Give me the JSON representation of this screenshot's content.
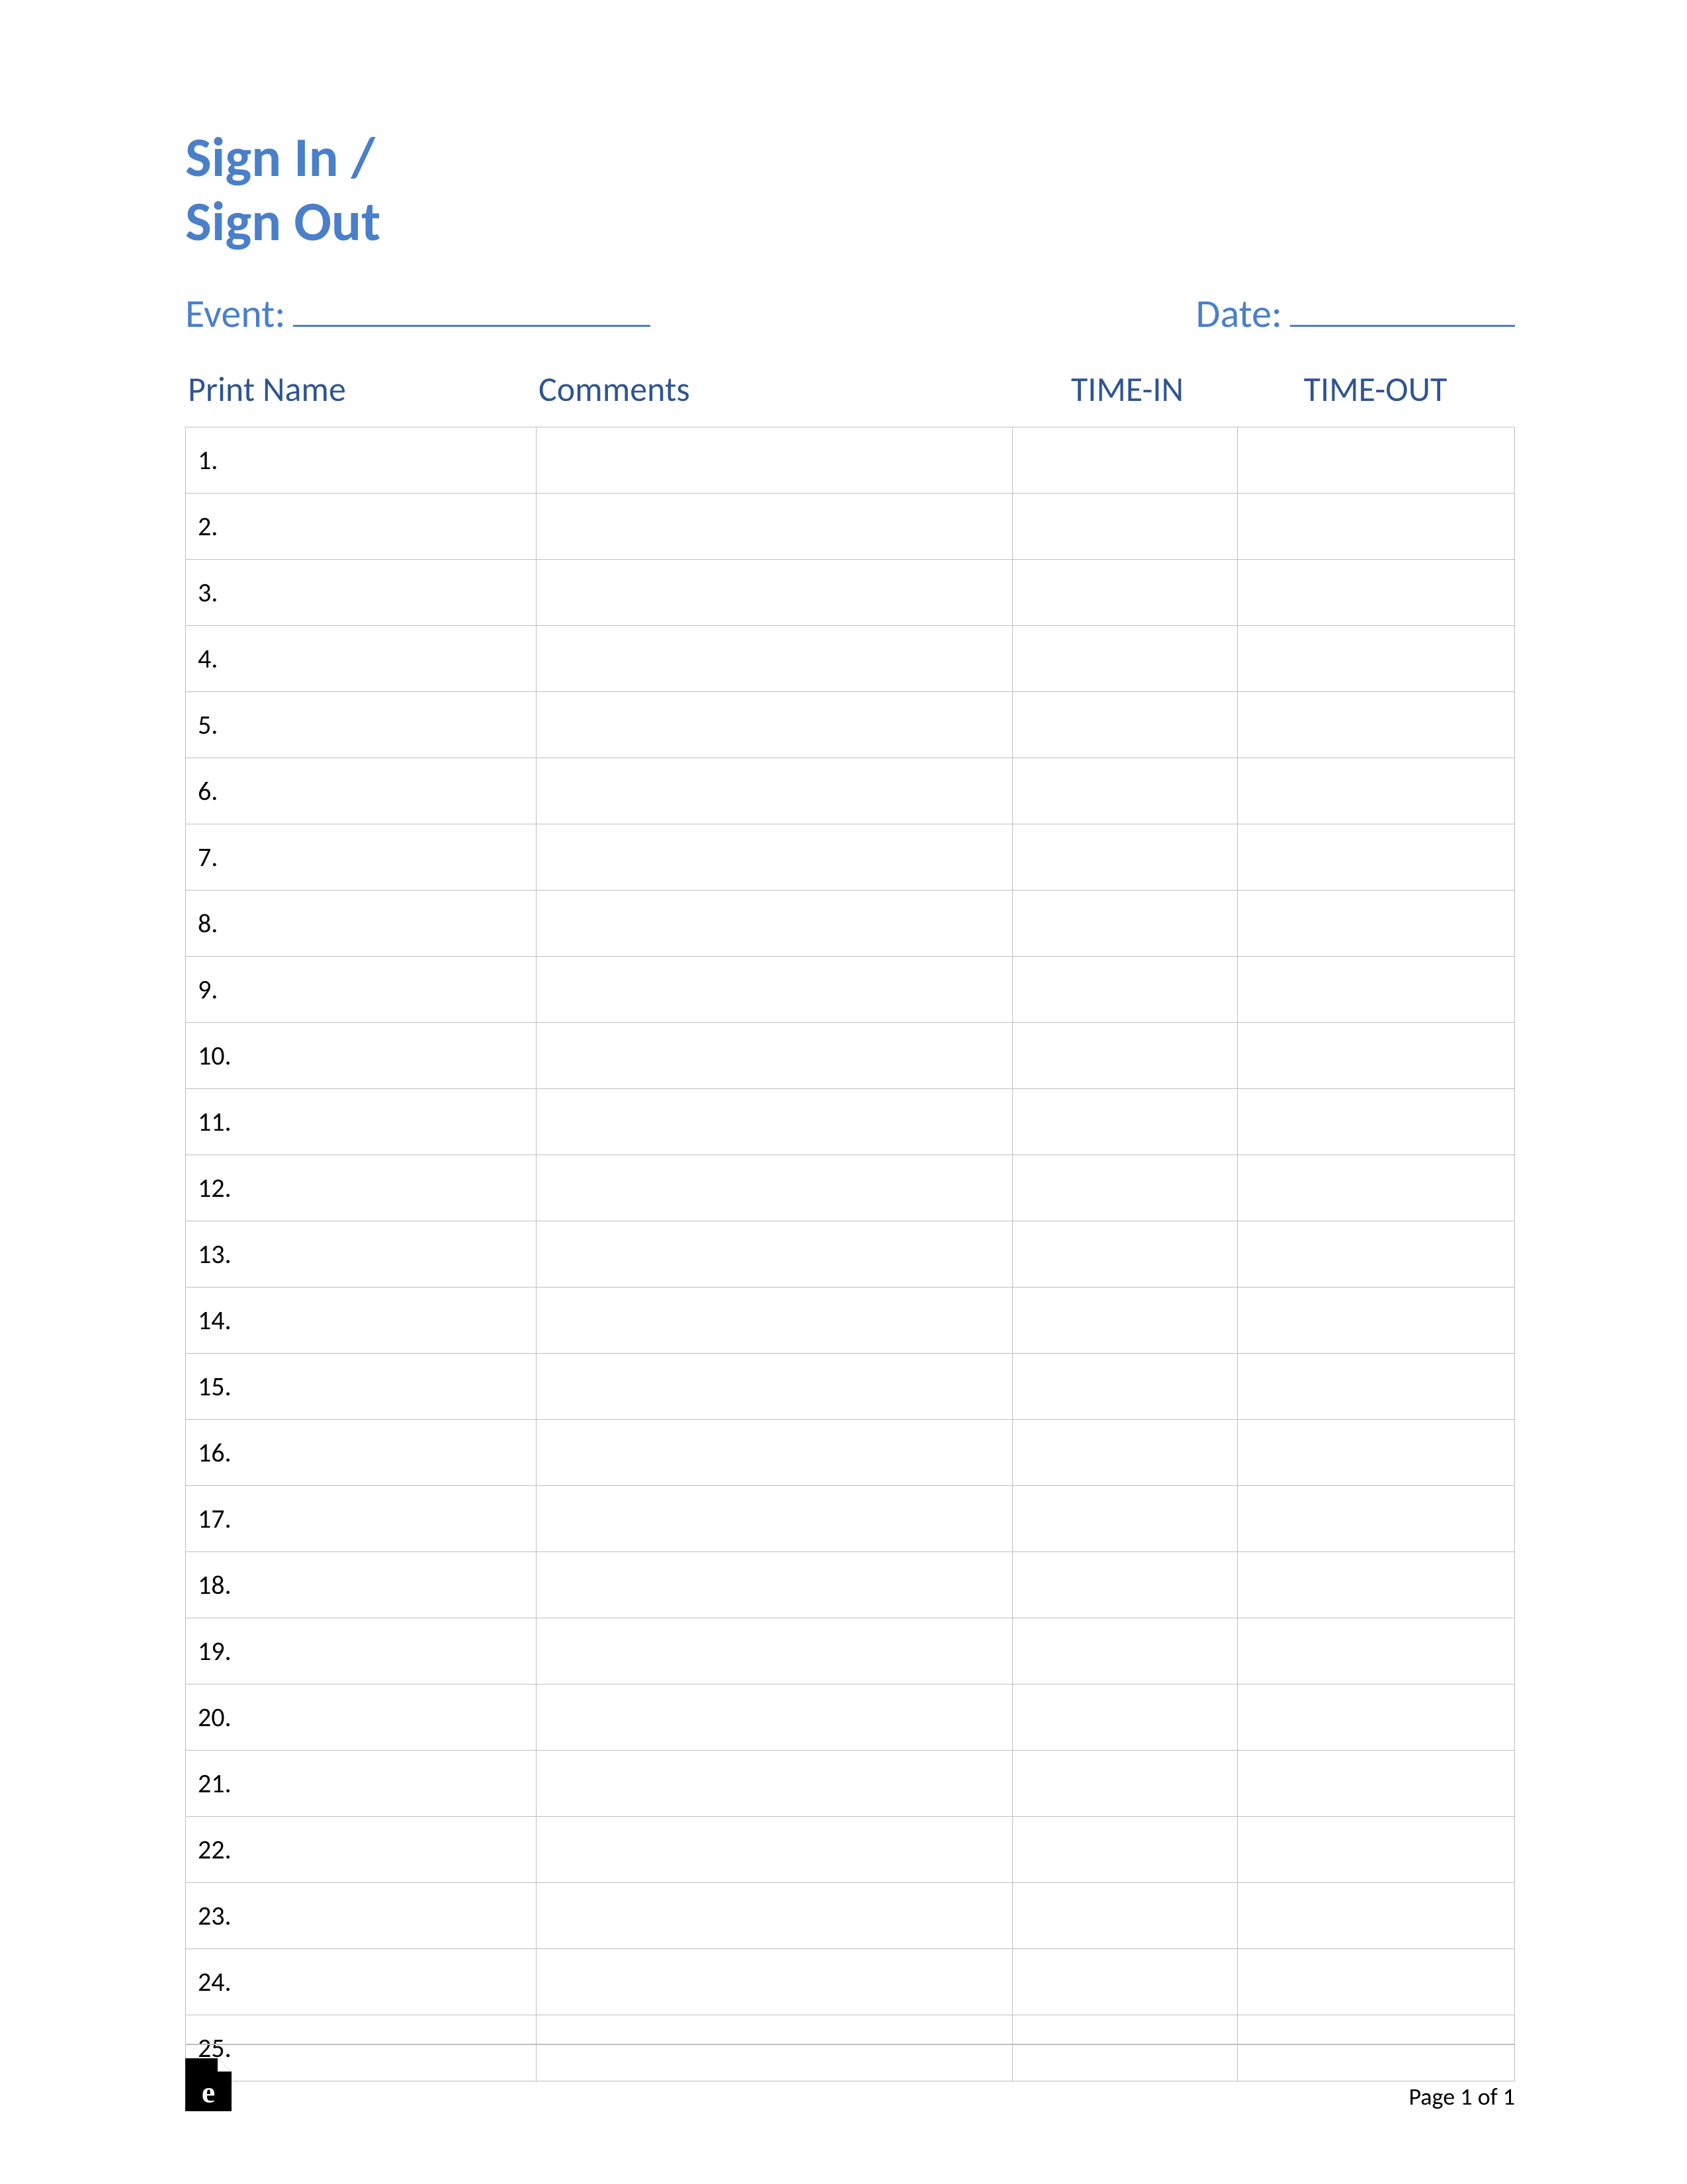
{
  "title_line1": "Sign In /",
  "title_line2": "Sign Out",
  "event_label": "Event:",
  "date_label": "Date:",
  "headers": {
    "name": "Print Name",
    "comments": "Comments",
    "time_in": "TIME-IN",
    "time_out": "TIME-OUT"
  },
  "rows": [
    {
      "num": "1.",
      "name": "",
      "comments": "",
      "time_in": "",
      "time_out": ""
    },
    {
      "num": "2.",
      "name": "",
      "comments": "",
      "time_in": "",
      "time_out": ""
    },
    {
      "num": "3.",
      "name": "",
      "comments": "",
      "time_in": "",
      "time_out": ""
    },
    {
      "num": "4.",
      "name": "",
      "comments": "",
      "time_in": "",
      "time_out": ""
    },
    {
      "num": "5.",
      "name": "",
      "comments": "",
      "time_in": "",
      "time_out": ""
    },
    {
      "num": "6.",
      "name": "",
      "comments": "",
      "time_in": "",
      "time_out": ""
    },
    {
      "num": "7.",
      "name": "",
      "comments": "",
      "time_in": "",
      "time_out": ""
    },
    {
      "num": "8.",
      "name": "",
      "comments": "",
      "time_in": "",
      "time_out": ""
    },
    {
      "num": "9.",
      "name": "",
      "comments": "",
      "time_in": "",
      "time_out": ""
    },
    {
      "num": "10.",
      "name": "",
      "comments": "",
      "time_in": "",
      "time_out": ""
    },
    {
      "num": "11.",
      "name": "",
      "comments": "",
      "time_in": "",
      "time_out": ""
    },
    {
      "num": "12.",
      "name": "",
      "comments": "",
      "time_in": "",
      "time_out": ""
    },
    {
      "num": "13.",
      "name": "",
      "comments": "",
      "time_in": "",
      "time_out": ""
    },
    {
      "num": "14.",
      "name": "",
      "comments": "",
      "time_in": "",
      "time_out": ""
    },
    {
      "num": "15.",
      "name": "",
      "comments": "",
      "time_in": "",
      "time_out": ""
    },
    {
      "num": "16.",
      "name": "",
      "comments": "",
      "time_in": "",
      "time_out": ""
    },
    {
      "num": "17.",
      "name": "",
      "comments": "",
      "time_in": "",
      "time_out": ""
    },
    {
      "num": "18.",
      "name": "",
      "comments": "",
      "time_in": "",
      "time_out": ""
    },
    {
      "num": "19.",
      "name": "",
      "comments": "",
      "time_in": "",
      "time_out": ""
    },
    {
      "num": "20.",
      "name": "",
      "comments": "",
      "time_in": "",
      "time_out": ""
    },
    {
      "num": "21.",
      "name": "",
      "comments": "",
      "time_in": "",
      "time_out": ""
    },
    {
      "num": "22.",
      "name": "",
      "comments": "",
      "time_in": "",
      "time_out": ""
    },
    {
      "num": "23.",
      "name": "",
      "comments": "",
      "time_in": "",
      "time_out": ""
    },
    {
      "num": "24.",
      "name": "",
      "comments": "",
      "time_in": "",
      "time_out": ""
    },
    {
      "num": "25.",
      "name": "",
      "comments": "",
      "time_in": "",
      "time_out": ""
    }
  ],
  "footer": {
    "logo_letter": "e",
    "page_text": "Page 1 of 1"
  }
}
